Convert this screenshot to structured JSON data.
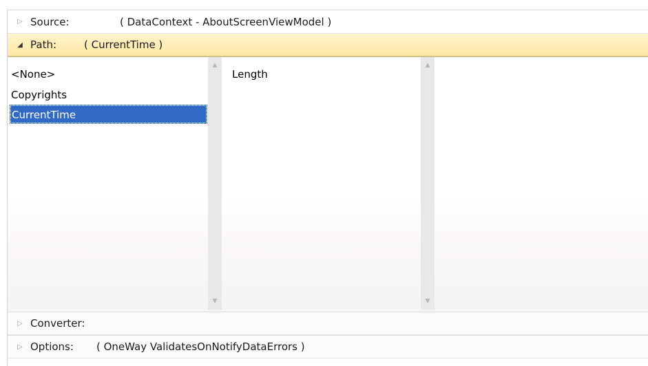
{
  "source": {
    "label": "Source:",
    "value": "( DataContext - AboutScreenViewModel )"
  },
  "path": {
    "label": "Path:",
    "value": "( CurrentTime )"
  },
  "properties": [
    {
      "label": "<None>"
    },
    {
      "label": "Copyrights"
    },
    {
      "label": "CurrentTime",
      "selected": true
    }
  ],
  "subproperties": [
    {
      "label": "Length"
    }
  ],
  "converter": {
    "label": "Converter:",
    "value": ""
  },
  "options": {
    "label": "Options:",
    "value": "( OneWay ValidatesOnNotifyDataErrors )"
  },
  "icons": {
    "collapsed": "triangle-right-icon",
    "expanded": "triangle-down-icon",
    "scroll_up": "scroll-up-arrow-icon",
    "scroll_down": "scroll-down-arrow-icon"
  },
  "colors": {
    "header_highlight": "#ffe7a3",
    "selection": "#3169c6"
  }
}
